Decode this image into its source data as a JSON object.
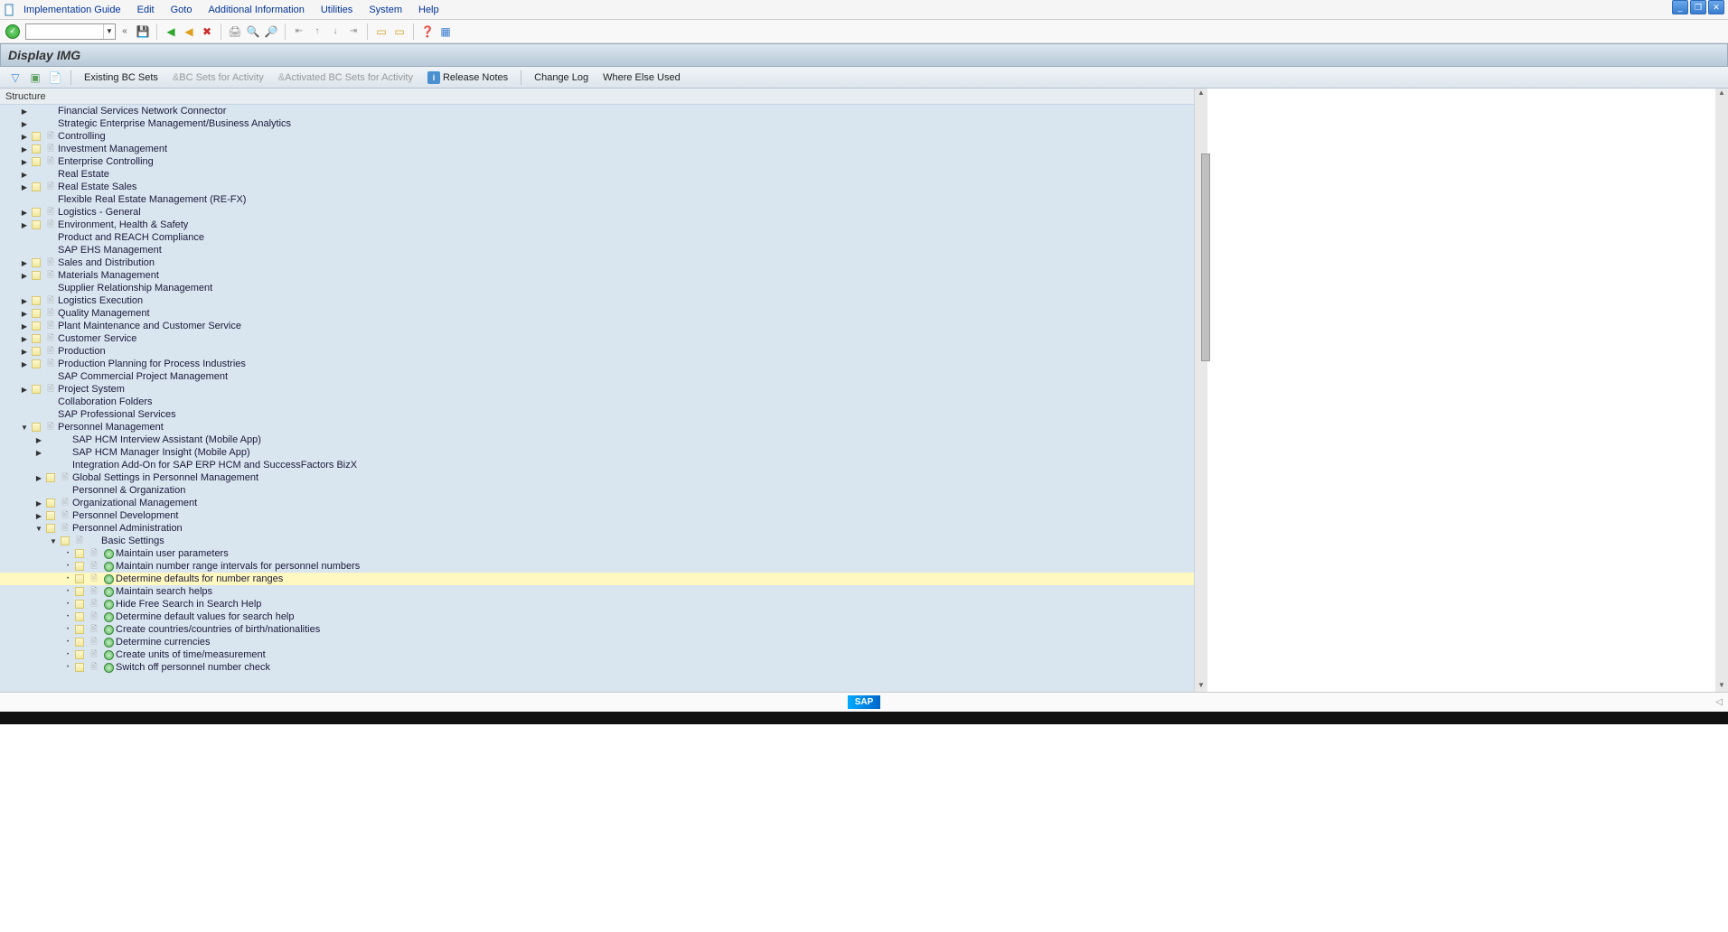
{
  "menu": [
    "Implementation Guide",
    "Edit",
    "Goto",
    "Additional Information",
    "Utilities",
    "System",
    "Help"
  ],
  "title": "Display IMG",
  "apptb": {
    "existing": "Existing BC Sets",
    "bcsets": "BC Sets for Activity",
    "activated": "Activated BC Sets for Activity",
    "release": "Release Notes",
    "changelog": "Change Log",
    "whereelse": "Where Else Used"
  },
  "tree_header": "Structure",
  "tree": [
    {
      "lvl": 1,
      "exp": "r",
      "icons": [],
      "label": "Financial Services Network Connector"
    },
    {
      "lvl": 1,
      "exp": "r",
      "icons": [],
      "label": "Strategic Enterprise Management/Business Analytics"
    },
    {
      "lvl": 1,
      "exp": "r",
      "icons": [
        "dy",
        "dg"
      ],
      "label": "Controlling"
    },
    {
      "lvl": 1,
      "exp": "r",
      "icons": [
        "dy",
        "dg"
      ],
      "label": "Investment Management"
    },
    {
      "lvl": 1,
      "exp": "r",
      "icons": [
        "dy",
        "dg"
      ],
      "label": "Enterprise Controlling"
    },
    {
      "lvl": 1,
      "exp": "r",
      "icons": [],
      "label": "Real Estate"
    },
    {
      "lvl": 1,
      "exp": "r",
      "icons": [
        "dy",
        "dg"
      ],
      "label": "Real Estate Sales"
    },
    {
      "lvl": 1,
      "exp": "",
      "icons": [],
      "label": "Flexible Real Estate Management (RE-FX)"
    },
    {
      "lvl": 1,
      "exp": "r",
      "icons": [
        "dy",
        "dg"
      ],
      "label": "Logistics - General"
    },
    {
      "lvl": 1,
      "exp": "r",
      "icons": [
        "dy",
        "dg"
      ],
      "label": "Environment, Health & Safety"
    },
    {
      "lvl": 1,
      "exp": "",
      "icons": [],
      "label": "Product and REACH Compliance"
    },
    {
      "lvl": 1,
      "exp": "",
      "icons": [],
      "label": "SAP EHS Management"
    },
    {
      "lvl": 1,
      "exp": "r",
      "icons": [
        "dy",
        "dg"
      ],
      "label": "Sales and Distribution"
    },
    {
      "lvl": 1,
      "exp": "r",
      "icons": [
        "dy",
        "dg"
      ],
      "label": "Materials Management"
    },
    {
      "lvl": 1,
      "exp": "",
      "icons": [],
      "label": "Supplier Relationship Management"
    },
    {
      "lvl": 1,
      "exp": "r",
      "icons": [
        "dy",
        "dg"
      ],
      "label": "Logistics Execution"
    },
    {
      "lvl": 1,
      "exp": "r",
      "icons": [
        "dy",
        "dg"
      ],
      "label": "Quality Management"
    },
    {
      "lvl": 1,
      "exp": "r",
      "icons": [
        "dy",
        "dg"
      ],
      "label": "Plant Maintenance and Customer Service"
    },
    {
      "lvl": 1,
      "exp": "r",
      "icons": [
        "dy",
        "dg"
      ],
      "label": "Customer Service"
    },
    {
      "lvl": 1,
      "exp": "r",
      "icons": [
        "dy",
        "dg"
      ],
      "label": "Production"
    },
    {
      "lvl": 1,
      "exp": "r",
      "icons": [
        "dy",
        "dg"
      ],
      "label": "Production Planning for Process Industries"
    },
    {
      "lvl": 1,
      "exp": "",
      "icons": [],
      "label": "SAP Commercial Project Management"
    },
    {
      "lvl": 1,
      "exp": "r",
      "icons": [
        "dy",
        "dg"
      ],
      "label": "Project System"
    },
    {
      "lvl": 1,
      "exp": "",
      "icons": [],
      "label": "Collaboration Folders"
    },
    {
      "lvl": 1,
      "exp": "",
      "icons": [],
      "label": "SAP Professional Services"
    },
    {
      "lvl": 1,
      "exp": "d",
      "icons": [
        "dy",
        "dg"
      ],
      "label": "Personnel Management"
    },
    {
      "lvl": 2,
      "exp": "r",
      "icons": [],
      "label": "SAP HCM Interview Assistant (Mobile App)"
    },
    {
      "lvl": 2,
      "exp": "r",
      "icons": [],
      "label": "SAP HCM Manager Insight (Mobile App)"
    },
    {
      "lvl": 2,
      "exp": "",
      "icons": [],
      "label": "Integration Add-On for SAP ERP HCM and SuccessFactors BizX"
    },
    {
      "lvl": 2,
      "exp": "r",
      "icons": [
        "dy",
        "dg"
      ],
      "label": "Global Settings in Personnel Management"
    },
    {
      "lvl": 2,
      "exp": "",
      "icons": [],
      "label": "Personnel & Organization"
    },
    {
      "lvl": 2,
      "exp": "r",
      "icons": [
        "dy",
        "dg"
      ],
      "label": "Organizational Management"
    },
    {
      "lvl": 2,
      "exp": "r",
      "icons": [
        "dy",
        "dg"
      ],
      "label": "Personnel Development"
    },
    {
      "lvl": 2,
      "exp": "d",
      "icons": [
        "dy",
        "dg"
      ],
      "label": "Personnel Administration"
    },
    {
      "lvl": 3,
      "exp": "d",
      "icons": [
        "dy",
        "dg"
      ],
      "label": "Basic Settings"
    },
    {
      "lvl": 4,
      "exp": "dot",
      "icons": [
        "dy",
        "dg",
        "ck"
      ],
      "label": "Maintain user parameters"
    },
    {
      "lvl": 4,
      "exp": "dot",
      "icons": [
        "dy",
        "dg",
        "ck"
      ],
      "label": "Maintain number range intervals for personnel numbers"
    },
    {
      "lvl": 4,
      "exp": "dot",
      "icons": [
        "dy",
        "dg",
        "ck"
      ],
      "label": "Determine defaults for number ranges",
      "hl": true
    },
    {
      "lvl": 4,
      "exp": "dot",
      "icons": [
        "dy",
        "dg",
        "ck"
      ],
      "label": "Maintain search helps"
    },
    {
      "lvl": 4,
      "exp": "dot",
      "icons": [
        "dy",
        "dg",
        "ck"
      ],
      "label": "Hide Free Search in Search Help"
    },
    {
      "lvl": 4,
      "exp": "dot",
      "icons": [
        "dy",
        "dg",
        "ck"
      ],
      "label": "Determine default values for search help"
    },
    {
      "lvl": 4,
      "exp": "dot",
      "icons": [
        "dy",
        "dg",
        "ck"
      ],
      "label": "Create countries/countries of birth/nationalities"
    },
    {
      "lvl": 4,
      "exp": "dot",
      "icons": [
        "dy",
        "dg",
        "ck"
      ],
      "label": "Determine currencies"
    },
    {
      "lvl": 4,
      "exp": "dot",
      "icons": [
        "dy",
        "dg",
        "ck"
      ],
      "label": "Create units of time/measurement"
    },
    {
      "lvl": 4,
      "exp": "dot",
      "icons": [
        "dy",
        "dg",
        "ck"
      ],
      "label": "Switch off personnel number check"
    }
  ],
  "sap": "SAP"
}
